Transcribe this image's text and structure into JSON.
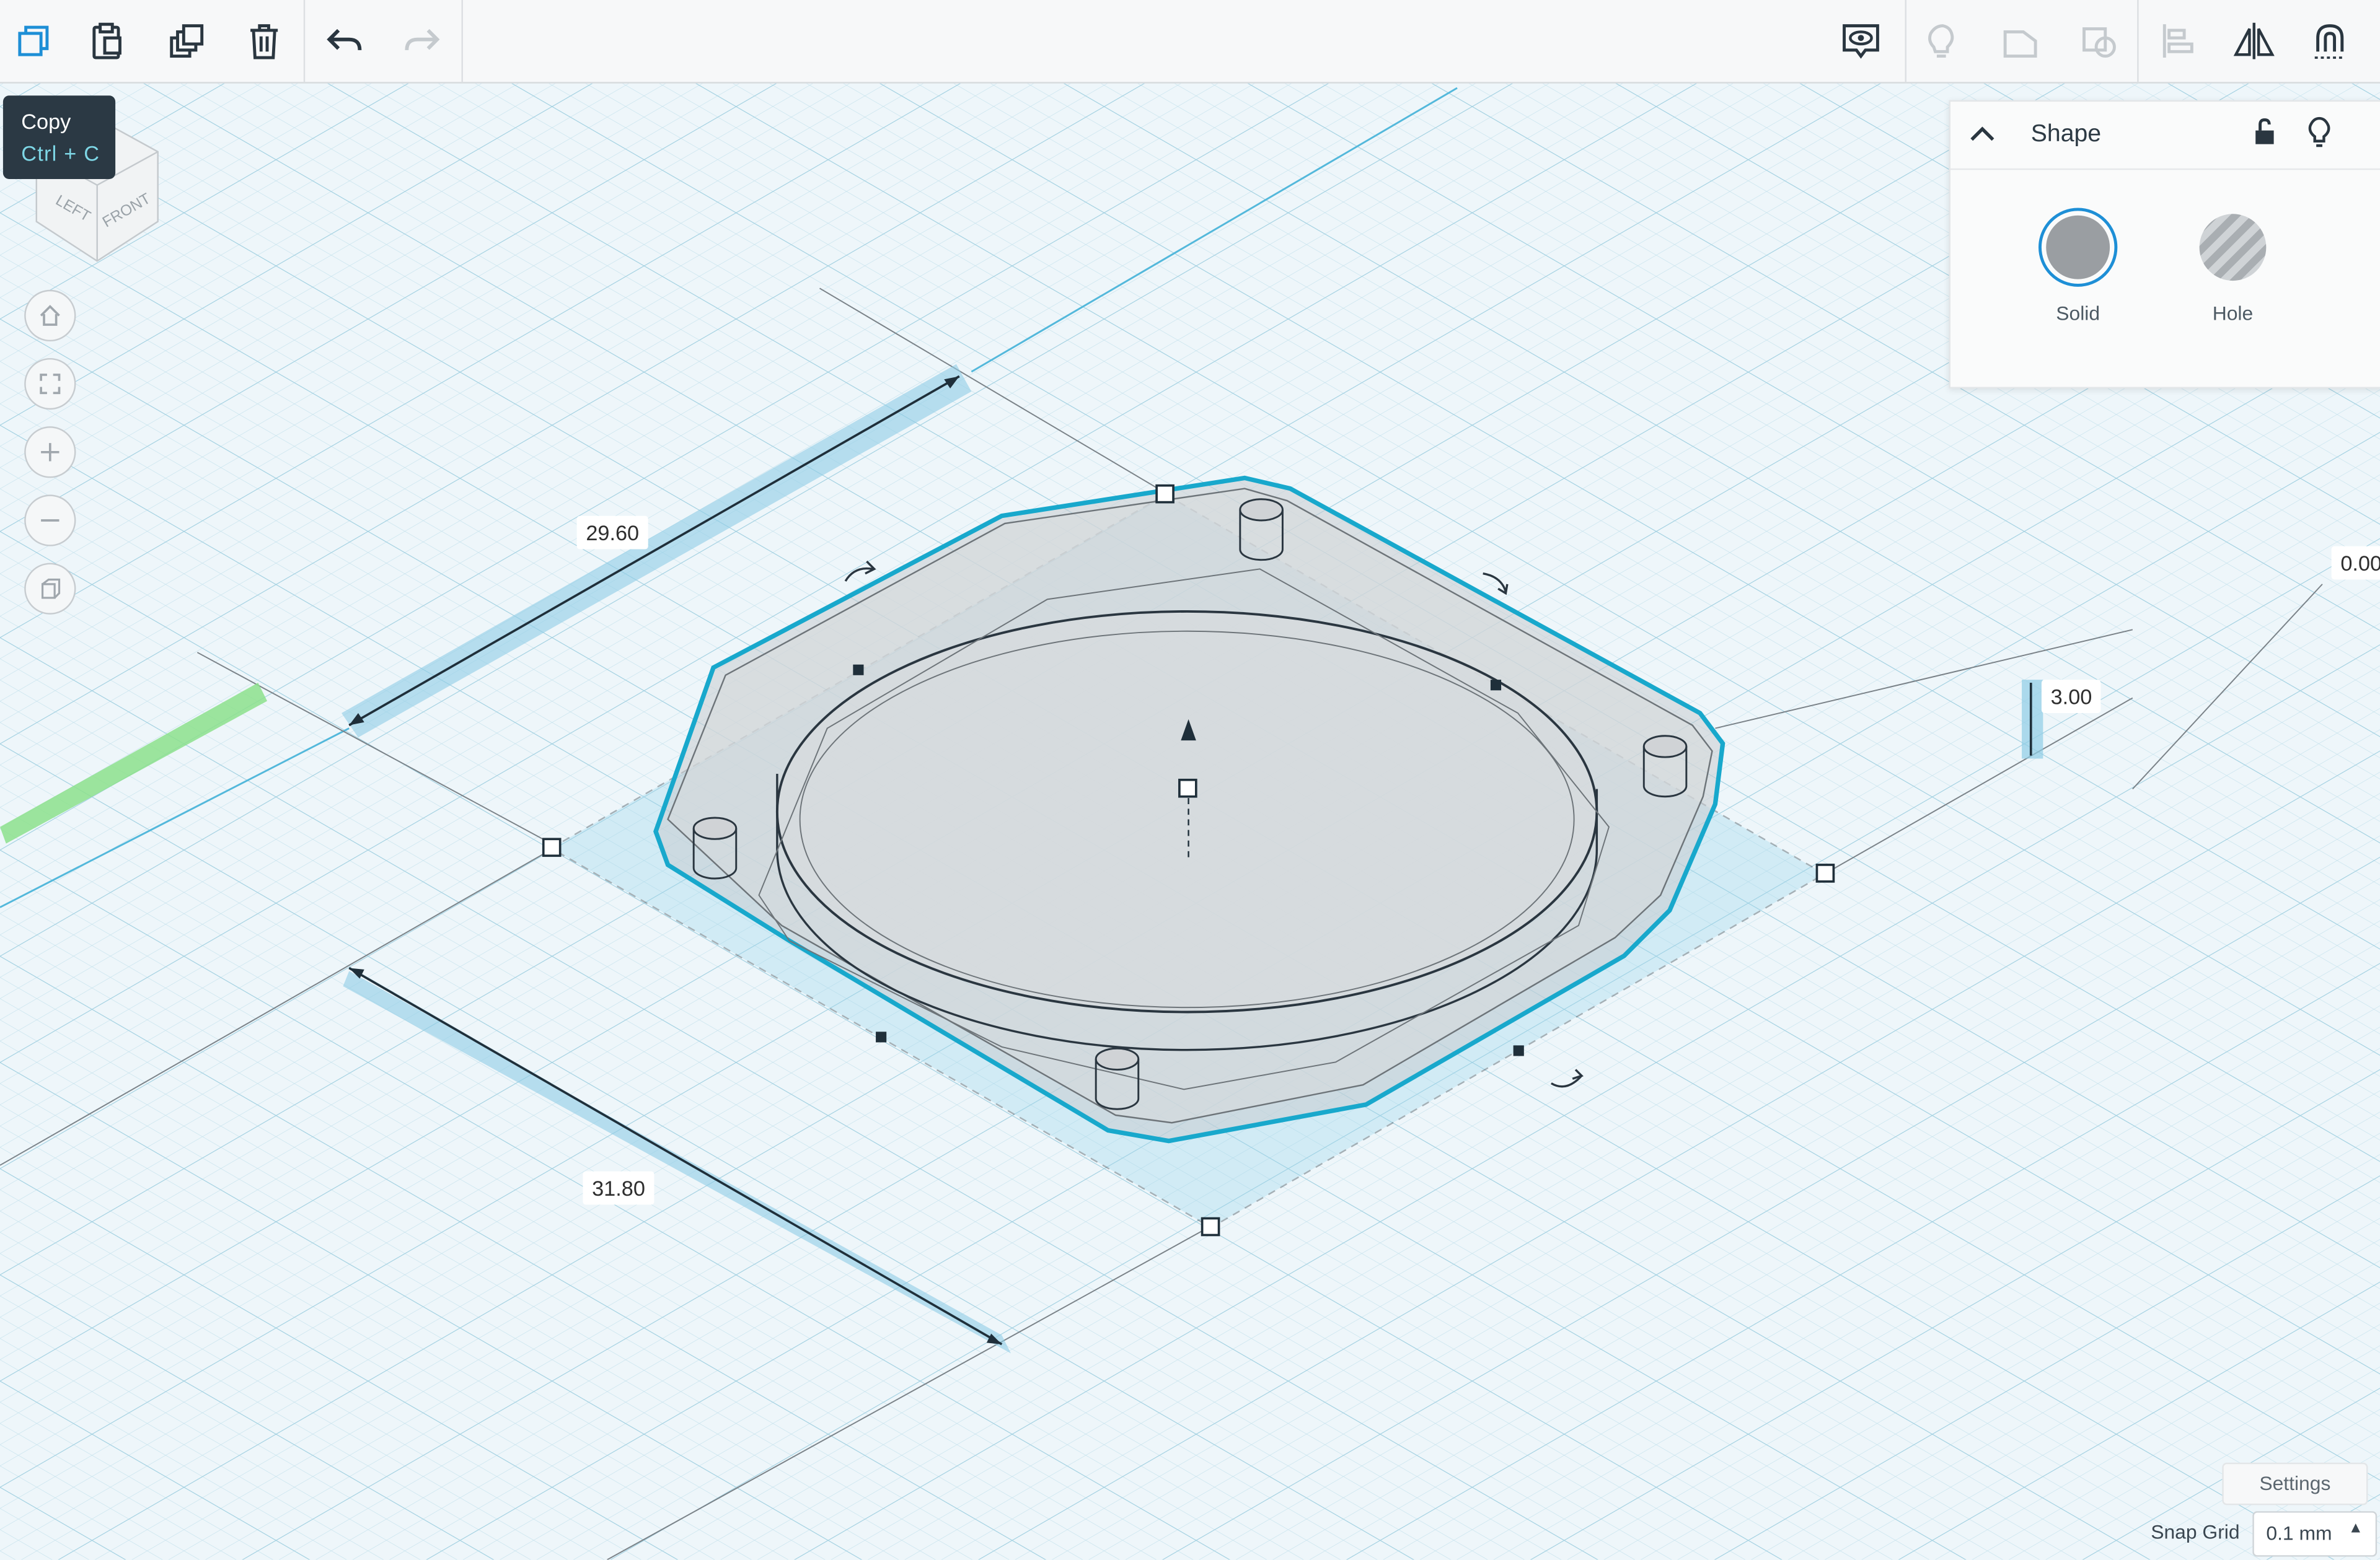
{
  "toolbar": {
    "left_tools": [
      "copy-icon",
      "paste-icon",
      "duplicate-icon",
      "trash-icon",
      "undo-icon",
      "redo-icon"
    ],
    "right_tools": [
      "show-all-icon",
      "notes-icon",
      "group-icon",
      "ungroup-icon",
      "align-icon",
      "mirror-icon",
      "cruise-icon"
    ]
  },
  "tooltip": {
    "label": "Copy",
    "shortcut": "Ctrl + C"
  },
  "viewcube": {
    "left": "LEFT",
    "front": "FRONT"
  },
  "shape_panel": {
    "title": "Shape",
    "solid_label": "Solid",
    "hole_label": "Hole",
    "solid_color": "#9a9ea2"
  },
  "dimensions": {
    "width": "29.60",
    "length": "31.80",
    "height": "3.00",
    "elevation": "0.00"
  },
  "footer": {
    "settings_label": "Settings",
    "snap_grid_label": "Snap Grid",
    "snap_grid_value": "0.1 mm"
  },
  "colors": {
    "accent": "#1fa6c8",
    "grid": "#b7dbe8",
    "x_axis": "#7fdd7f"
  }
}
